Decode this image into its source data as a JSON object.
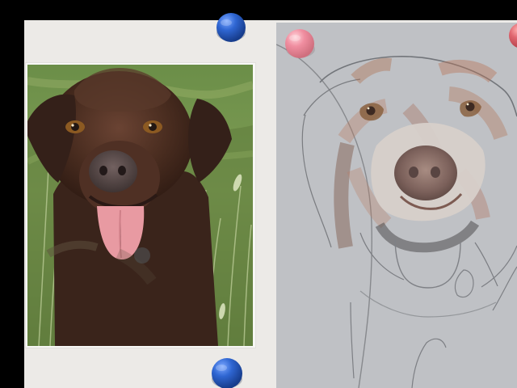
{
  "scene": {
    "background_color": "#000000",
    "board_color": "#eceae7",
    "paper_color": "#bfc1c5",
    "photo_border_color": "#f7f7f5"
  },
  "photo": {
    "subject_icon": "chocolate-labrador-photo",
    "fur_color": "#4a2d20",
    "grass_color": "#7a9850"
  },
  "sketch": {
    "subject_icon": "dog-portrait-pencil-sketch",
    "accent_color": "#a9765d"
  },
  "magnets": {
    "blue_color": "#2456b8",
    "pink_color": "#ee8a9a",
    "red_color": "#d95b63"
  }
}
